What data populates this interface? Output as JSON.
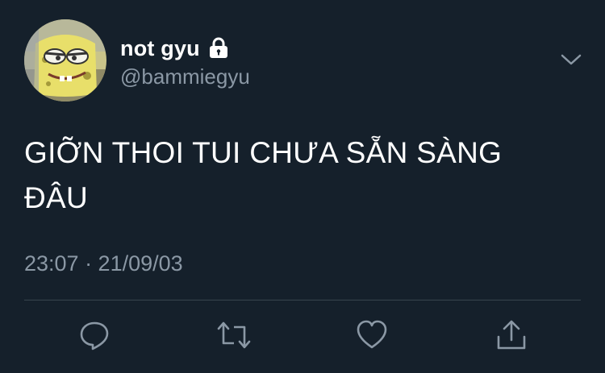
{
  "user": {
    "display_name": "not gyu",
    "handle": "@bammiegyu",
    "protected": true,
    "avatar": "spongebob-avatar"
  },
  "tweet": {
    "text_line1": "GIỠN THOI TUI CHƯA SẴN SÀNG",
    "text_line2": "ĐÂU",
    "timestamp": "23:07 · 21/09/03"
  },
  "icons": {
    "lock": "lock-icon",
    "more": "chevron-down-icon",
    "reply": "reply-icon",
    "retweet": "retweet-icon",
    "like": "heart-icon",
    "share": "share-icon"
  },
  "colors": {
    "background": "#15202b",
    "text": "#ffffff",
    "secondary": "#8b98a5",
    "divider": "#38444d"
  }
}
